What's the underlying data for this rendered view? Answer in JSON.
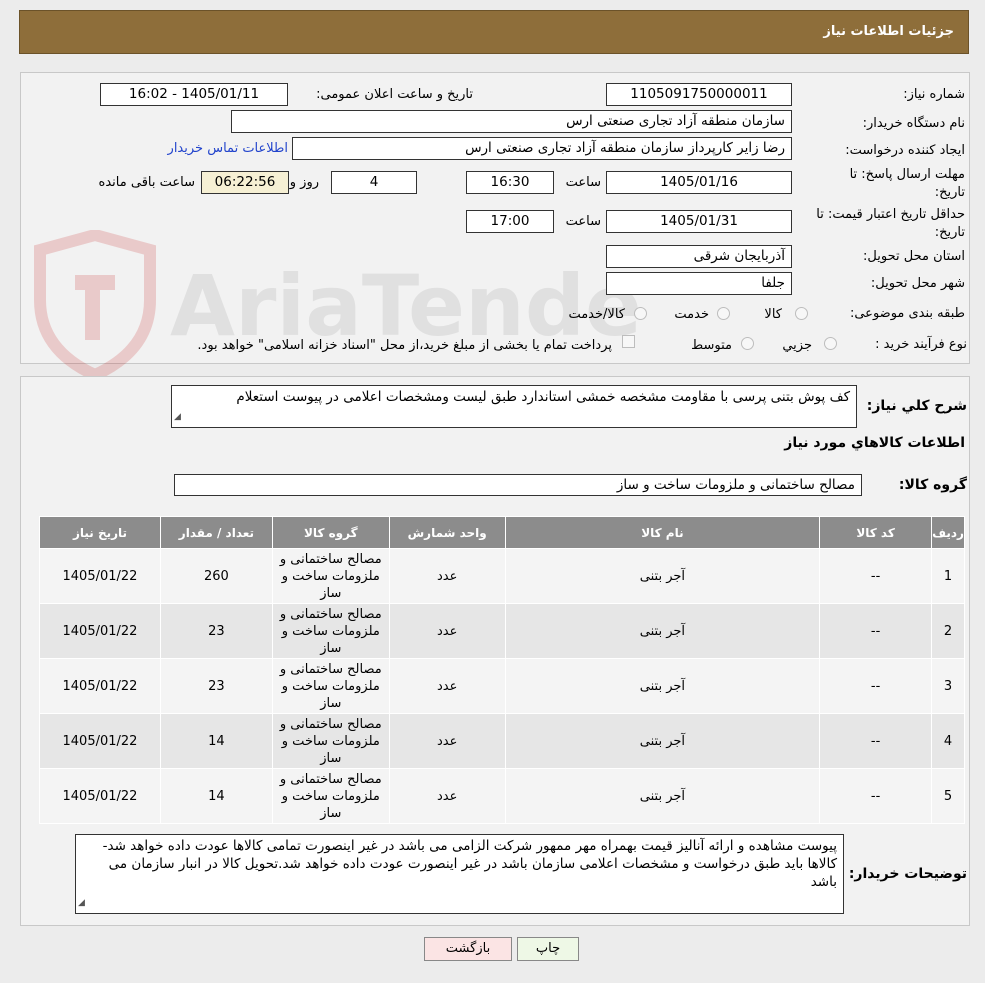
{
  "header": {
    "title": "جزئیات اطلاعات نیاز"
  },
  "watermark": {
    "text": "AriaTender.neT"
  },
  "form": {
    "need_number_label": "شماره نیاز:",
    "need_number": "1105091750000011",
    "announce_label": "تاریخ و ساعت اعلان عمومی:",
    "announce_value": "1405/01/11 - 16:02",
    "buyer_org_label": "نام دستگاه خریدار:",
    "buyer_org": "سازمان منطقه آزاد تجاری صنعتی ارس",
    "creator_label": "ایجاد کننده درخواست:",
    "creator": "رضا زاير كارپرداز سازمان منطقه آزاد تجاری صنعتی ارس",
    "contact_link": "اطلاعات تماس خریدار",
    "deadline_label_1": "مهلت ارسال پاسخ: تا",
    "deadline_label_2": "تاریخ:",
    "deadline_date": "1405/01/16",
    "hour_label": "ساعت",
    "deadline_time": "16:30",
    "days_value": "4",
    "days_label": "روز و",
    "remaining_time": "06:22:56",
    "remaining_label": "ساعت باقی مانده",
    "validity_label_1": "حداقل تاریخ اعتبار قیمت: تا",
    "validity_label_2": "تاریخ:",
    "validity_date": "1405/01/31",
    "validity_time": "17:00",
    "province_label": "استان محل تحویل:",
    "province": "آذربایجان شرقی",
    "city_label": "شهر محل تحویل:",
    "city": "جلفا",
    "category_label": "طبقه بندی موضوعی:",
    "category_options": [
      "کالا",
      "خدمت",
      "کالا/خدمت"
    ],
    "process_label": "نوع فرآیند خرید :",
    "process_options": [
      "جزیي",
      "متوسط"
    ],
    "payment_note": "پرداخت تمام یا بخشی از مبلغ خرید،از محل \"اسناد خزانه اسلامی\" خواهد بود."
  },
  "details": {
    "summary_label": "شرح کلي نياز:",
    "summary": "کف پوش بتنی پرسی با مقاومت مشخصه خمشی استاندارد طبق لیست ومشخصات اعلامی در پیوست استعلام",
    "goods_info_title": "اطلاعات کالاهاي مورد نياز",
    "goods_group_label": "گروه کالا:",
    "goods_group": "مصالح ساختمانی و ملزومات ساخت و ساز"
  },
  "table": {
    "headers": [
      "رديف",
      "کد کالا",
      "نام کالا",
      "واحد شمارش",
      "گروه کالا",
      "تعداد / مقدار",
      "تاريخ نياز"
    ],
    "rows": [
      {
        "row": "1",
        "code": "--",
        "name": "آجر بتنی",
        "unit": "عدد",
        "group": "مصالح ساختمانی و ملزومات ساخت و ساز",
        "qty": "260",
        "date": "1405/01/22"
      },
      {
        "row": "2",
        "code": "--",
        "name": "آجر بتنی",
        "unit": "عدد",
        "group": "مصالح ساختمانی و ملزومات ساخت و ساز",
        "qty": "23",
        "date": "1405/01/22"
      },
      {
        "row": "3",
        "code": "--",
        "name": "آجر بتنی",
        "unit": "عدد",
        "group": "مصالح ساختمانی و ملزومات ساخت و ساز",
        "qty": "23",
        "date": "1405/01/22"
      },
      {
        "row": "4",
        "code": "--",
        "name": "آجر بتنی",
        "unit": "عدد",
        "group": "مصالح ساختمانی و ملزومات ساخت و ساز",
        "qty": "14",
        "date": "1405/01/22"
      },
      {
        "row": "5",
        "code": "--",
        "name": "آجر بتنی",
        "unit": "عدد",
        "group": "مصالح ساختمانی و ملزومات ساخت و ساز",
        "qty": "14",
        "date": "1405/01/22"
      }
    ]
  },
  "buyer_notes": {
    "label": "توضیحات خریدار:",
    "text": "پیوست مشاهده و ارائه آنالیز قیمت بهمراه مهر ممهور شرکت الزامی می باشد در غیر اینصورت تمامی کالاها عودت داده خواهد شد-کالاها  باید طبق درخواست و مشخصات اعلامی سازمان باشد در غیر اینصورت عودت داده خواهد شد.تحویل کالا در انبار سازمان می باشد"
  },
  "buttons": {
    "print": "چاپ",
    "back": "بازگشت"
  }
}
